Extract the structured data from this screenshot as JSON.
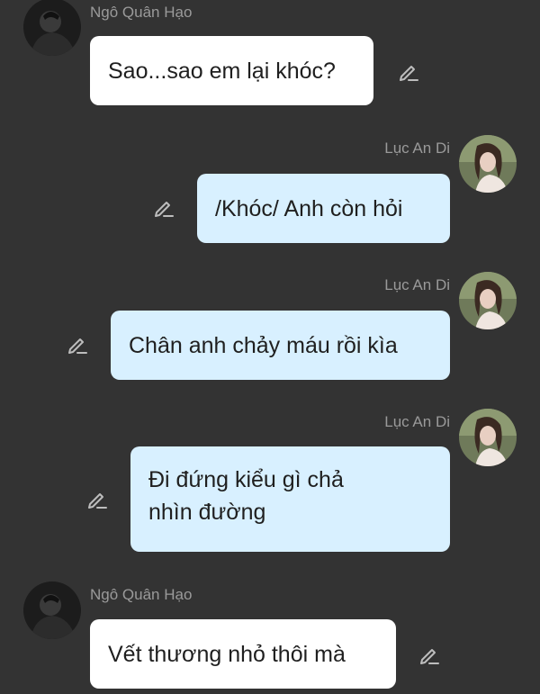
{
  "messages": [
    {
      "sender": "Ngô Quân Hạo",
      "text": "Sao...sao em lại khóc?",
      "side": "left"
    },
    {
      "sender": "Lục An Di",
      "text": "/Khóc/ Anh còn hỏi",
      "side": "right"
    },
    {
      "sender": "Lục An Di",
      "text": "Chân anh chảy máu rồi kìa",
      "side": "right"
    },
    {
      "sender": "Lục An Di",
      "text_line1": "Đi đứng kiểu gì chả",
      "text_line2": "nhìn đường",
      "side": "right"
    },
    {
      "sender": "Ngô Quân Hạo",
      "text": "Vết thương nhỏ thôi mà",
      "side": "left"
    }
  ],
  "colors": {
    "background": "#333333",
    "left_bubble": "#ffffff",
    "right_bubble": "#d8f0ff",
    "name_text": "#9a9a9a"
  },
  "icons": {
    "edit": "pencil-icon",
    "avatar_left": "dark-avatar",
    "avatar_right": "girl-avatar"
  }
}
